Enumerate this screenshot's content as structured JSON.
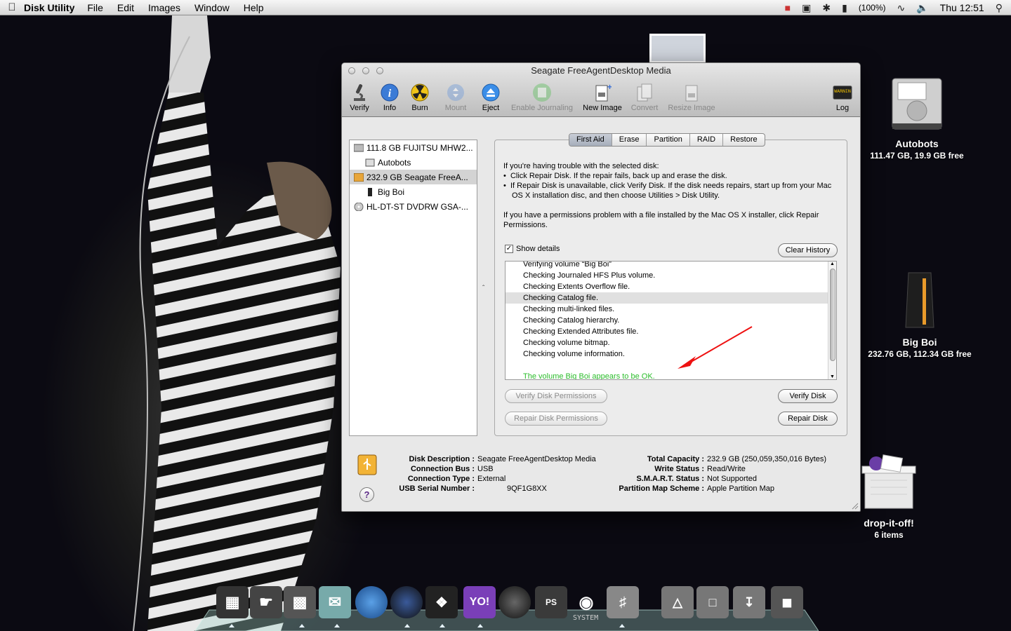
{
  "menubar": {
    "app_name": "Disk Utility",
    "menus": [
      "File",
      "Edit",
      "Images",
      "Window",
      "Help"
    ],
    "battery": "(100%)",
    "clock": "Thu 12:51"
  },
  "window": {
    "title": "Seagate FreeAgentDesktop Media",
    "toolbar": {
      "verify": "Verify",
      "info": "Info",
      "burn": "Burn",
      "mount": "Mount",
      "eject": "Eject",
      "enable_journaling": "Enable Journaling",
      "new_image": "New Image",
      "convert": "Convert",
      "resize_image": "Resize Image",
      "log": "Log",
      "log_icon_text": "WARNIN"
    },
    "sidebar": {
      "items": [
        {
          "label": "111.8 GB FUJITSU MHW2..."
        },
        {
          "label": "Autobots"
        },
        {
          "label": "232.9 GB Seagate FreeA..."
        },
        {
          "label": "Big Boi"
        },
        {
          "label": "HL-DT-ST DVDRW GSA-..."
        }
      ]
    },
    "tabs": [
      "First Aid",
      "Erase",
      "Partition",
      "RAID",
      "Restore"
    ],
    "first_aid": {
      "intro": "If you're having trouble with the selected disk:",
      "bullet1": "Click Repair Disk. If the repair fails, back up and erase the disk.",
      "bullet2": "If Repair Disk is unavailable, click Verify Disk. If the disk needs repairs, start up from your Mac OS X installation disc, and then choose Utilities > Disk Utility.",
      "permissions_note": "If you have a permissions problem with a file installed by the Mac OS X installer, click Repair Permissions.",
      "show_details": "Show details",
      "clear_history": "Clear History",
      "log_lines": [
        "Verifying volume “Big Boi”",
        "Checking Journaled HFS Plus volume.",
        "Checking Extents Overflow file.",
        "Checking Catalog file.",
        "Checking multi-linked files.",
        "Checking Catalog hierarchy.",
        "Checking Extended Attributes file.",
        "Checking volume bitmap.",
        "Checking volume information.",
        "",
        "The volume Big Boi appears to be OK."
      ],
      "verify_permissions": "Verify Disk Permissions",
      "repair_permissions": "Repair Disk Permissions",
      "verify_disk": "Verify Disk",
      "repair_disk": "Repair Disk"
    },
    "info": {
      "help": "?",
      "left": [
        {
          "k": "Disk Description :",
          "v": "Seagate FreeAgentDesktop Media"
        },
        {
          "k": "Connection Bus :",
          "v": "USB"
        },
        {
          "k": "Connection Type :",
          "v": "External"
        },
        {
          "k": "USB Serial Number :",
          "v": "9QF1G8XX"
        }
      ],
      "right": [
        {
          "k": "Total Capacity :",
          "v": "232.9 GB (250,059,350,016 Bytes)"
        },
        {
          "k": "Write Status :",
          "v": "Read/Write"
        },
        {
          "k": "S.M.A.R.T. Status :",
          "v": "Not Supported"
        },
        {
          "k": "Partition Map Scheme :",
          "v": "Apple Partition Map"
        }
      ]
    }
  },
  "desktop": {
    "autobots": {
      "name": "Autobots",
      "info": "111.47 GB, 19.9 GB free"
    },
    "bigboi": {
      "name": "Big Boi",
      "info": "232.76 GB, 112.34 GB free"
    },
    "dropitoff": {
      "name": "drop-it-off!",
      "info": "6 items"
    }
  },
  "dock": {
    "yo_label": "YO!",
    "ps_label": "PS",
    "system_label": "SYSTEM"
  }
}
